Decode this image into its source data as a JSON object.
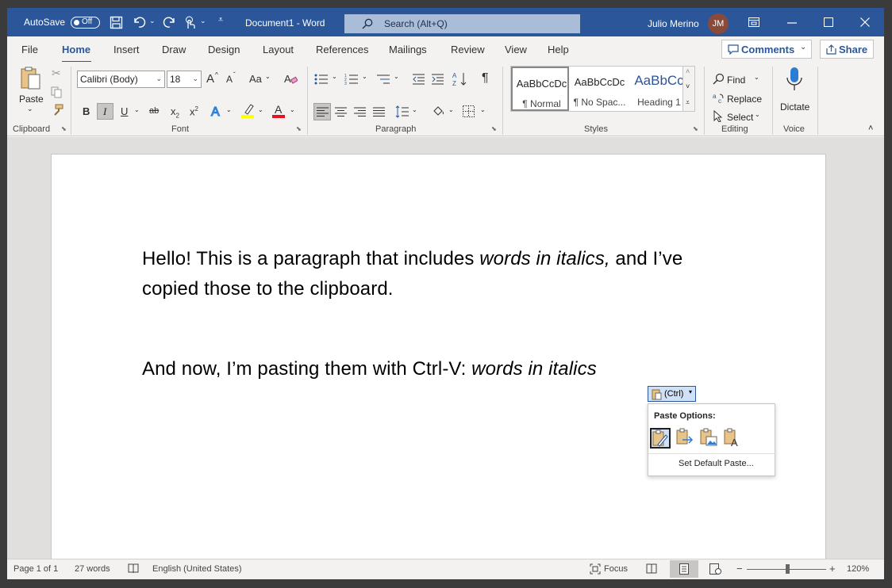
{
  "titlebar": {
    "autosave_label": "AutoSave",
    "autosave_state": "Off",
    "doc_title": "Document1  -  Word",
    "search_placeholder": "Search (Alt+Q)",
    "user_name": "Julio Merino",
    "user_initials": "JM"
  },
  "tabs": [
    "File",
    "Home",
    "Insert",
    "Draw",
    "Design",
    "Layout",
    "References",
    "Mailings",
    "Review",
    "View",
    "Help"
  ],
  "active_tab": "Home",
  "comments_label": "Comments",
  "share_label": "Share",
  "ribbon": {
    "clipboard": {
      "paste_label": "Paste",
      "group_label": "Clipboard"
    },
    "font": {
      "font_name": "Calibri (Body)",
      "font_size": "18",
      "group_label": "Font",
      "case_label": "Aa",
      "grow": "A",
      "shrink": "A",
      "bold": "B",
      "italic": "I",
      "underline": "U",
      "strike": "ab",
      "sub": "x",
      "sup": "x"
    },
    "paragraph": {
      "group_label": "Paragraph",
      "pilcrow": "¶"
    },
    "styles": {
      "group_label": "Styles",
      "items": [
        {
          "sample": "AaBbCcDc",
          "name": "¶ Normal"
        },
        {
          "sample": "AaBbCcDc",
          "name": "¶ No Spac..."
        },
        {
          "sample": "AaBbCc",
          "name": "Heading 1"
        }
      ]
    },
    "editing": {
      "group_label": "Editing",
      "find": "Find",
      "replace": "Replace",
      "select": "Select"
    },
    "voice": {
      "group_label": "Voice",
      "dictate": "Dictate"
    }
  },
  "document": {
    "para1_line1_before": "Hello! This is a paragraph that includes ",
    "para1_line1_italic": "words in italics,",
    "para1_line1_after": " and I’ve",
    "para1_line2": "copied those to the clipboard.",
    "para2_before": "And now, I’m pasting them with Ctrl-V: ",
    "para2_italic": "words in italics"
  },
  "paste_popup": {
    "chip_label": "(Ctrl)",
    "title": "Paste Options:",
    "default_label": "Set Default Paste..."
  },
  "statusbar": {
    "page": "Page 1 of 1",
    "words": "27 words",
    "language": "English (United States)",
    "focus": "Focus",
    "zoom": "120%"
  },
  "colors": {
    "brand": "#2b579a",
    "highlight": "#ffff00",
    "font_color": "#e81123"
  }
}
